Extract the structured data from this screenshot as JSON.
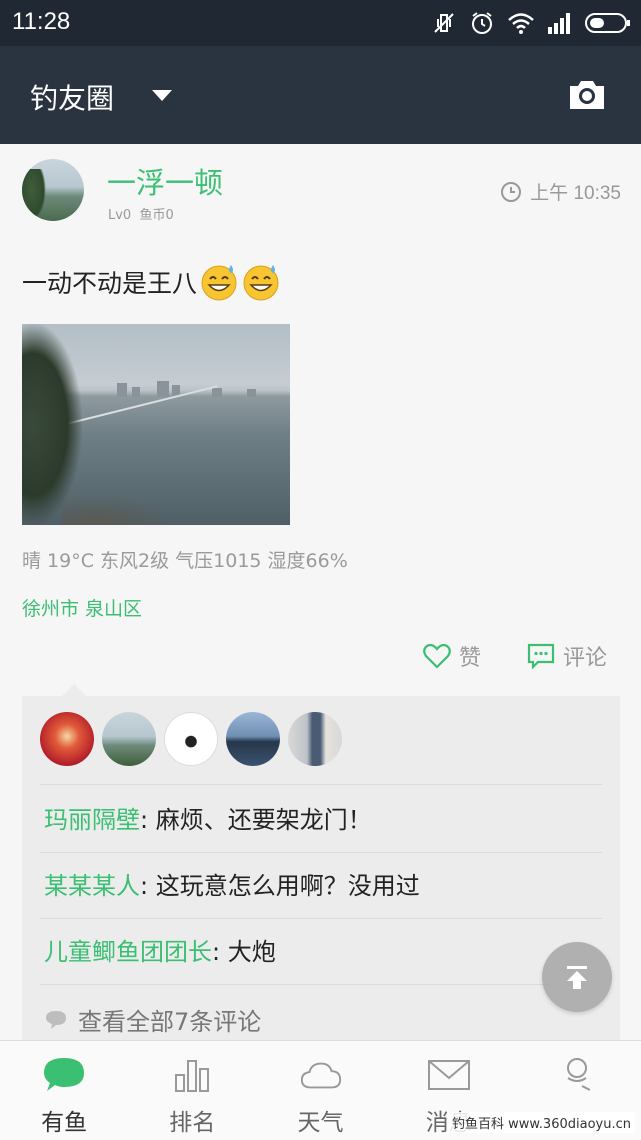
{
  "status_bar": {
    "time": "11:28",
    "icons": [
      "vibrate-off-icon",
      "alarm-icon",
      "wifi-icon",
      "signal-icon",
      "battery-icon"
    ]
  },
  "app_bar": {
    "title": "钓友圈",
    "dropdown_icon": "dropdown-arrow-icon",
    "camera_icon": "camera-icon"
  },
  "post": {
    "username": "一浮一顿",
    "level": "Lv0",
    "coins": "鱼币0",
    "time": "上午 10:35",
    "text": "一动不动是王八",
    "weather": "晴  19°C  东风2级  气压1015  湿度66%",
    "location": "徐州市 泉山区",
    "actions": {
      "like": "赞",
      "comment": "评论"
    }
  },
  "comments": {
    "items": [
      {
        "name": "玛丽隔壁",
        "text": ": 麻烦、还要架龙门！"
      },
      {
        "name": "某某某人",
        "text": ": 这玩意怎么用啊？没用过"
      },
      {
        "name": "儿童鲫鱼团团长",
        "text": ": 大炮"
      }
    ],
    "view_all": "查看全部7条评论"
  },
  "bottom_nav": {
    "items": [
      {
        "label": "有鱼",
        "icon": "chat-bubble-icon",
        "active": true
      },
      {
        "label": "排名",
        "icon": "bar-chart-icon",
        "active": false
      },
      {
        "label": "天气",
        "icon": "cloud-icon",
        "active": false
      },
      {
        "label": "消息",
        "icon": "mail-icon",
        "active": false
      },
      {
        "label": "",
        "icon": "user-icon",
        "active": false
      }
    ]
  },
  "watermark": "钓鱼百科 www.360diaoyu.cn",
  "colors": {
    "accent_green": "#3bbf73",
    "app_bar": "#2a3340",
    "status_bar": "#1f2833"
  }
}
